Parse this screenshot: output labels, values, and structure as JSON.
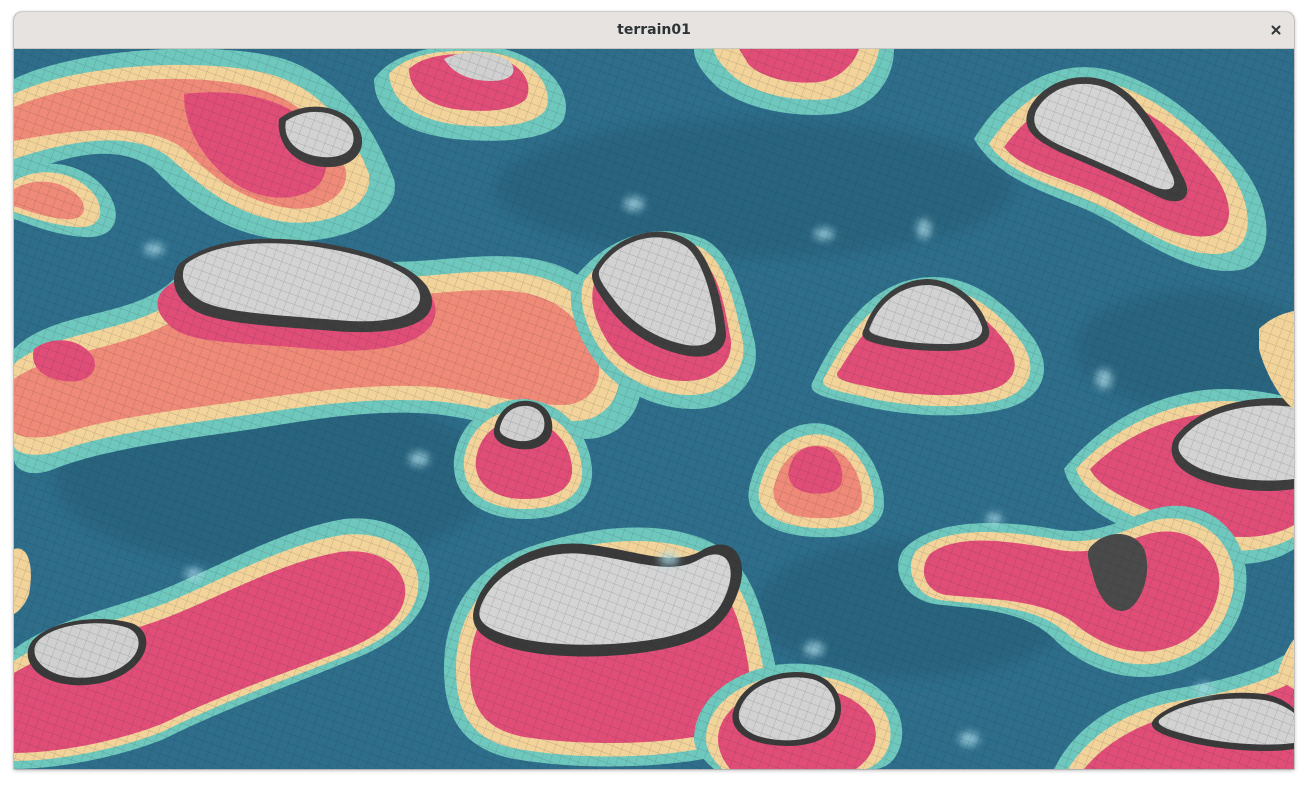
{
  "window": {
    "title": "terrain01",
    "close_icon": "close-icon"
  },
  "scene": {
    "description_icon": "terrain-heightmap",
    "palette": {
      "water": "#2f6f8c",
      "water_dark": "#245b74",
      "shore": "#6fc8bd",
      "mint": "#9fe0c8",
      "sand": "#f2d39a",
      "coral": "#f08a78",
      "pink": "#e04e78",
      "rock": "#4a4a4a",
      "snow": "#d6d6d6",
      "highlight": "#9fd3e6"
    }
  }
}
